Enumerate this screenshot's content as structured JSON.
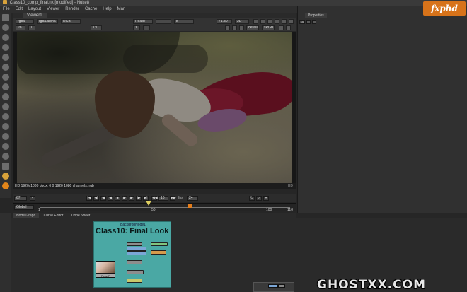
{
  "window": {
    "title": "Class10_comp_final.nk [modified] - Nuke8"
  },
  "menu": [
    "File",
    "Edit",
    "Layout",
    "Viewer",
    "Render",
    "Cache",
    "Help",
    "Mari"
  ],
  "viewer": {
    "tab_label": "Viewer1",
    "channels": "rgba",
    "alpha_channel": "rgba.alpha",
    "color_mode": "RGB",
    "input_a": "Read7",
    "input_b_label": "B",
    "gain": "f/8",
    "gain_value": "1",
    "zoom": "1:1",
    "gamma_label": "Y",
    "gamma_value": "1",
    "scale": "+1.30",
    "view_mode": "2D",
    "lut": "default",
    "colorspace": "sRGB",
    "info_line": "HD 1920x1080  bbox: 0 0 1920 1080  channels: rgb",
    "format_tag": "HD"
  },
  "playback": {
    "current_frame": "67",
    "step": "10",
    "fps_label": "fps",
    "fps_value": "24",
    "range_mode": "Global",
    "start_frame": "1",
    "end_frame": "110",
    "tick_50": "50",
    "tick_100": "100",
    "current_pct": 0.6
  },
  "node_graph": {
    "tabs": [
      "Node Graph",
      "Curve Editor",
      "Dope Sheet"
    ],
    "backdrop_name": "BackdropNode1",
    "backdrop_title": "Class10: Final Look",
    "read_node": "Read7"
  },
  "properties": {
    "tab_label": "Properties",
    "max_panels": "10"
  },
  "branding": {
    "logo": "fxphd",
    "watermark": "GHOSTXX.COM"
  },
  "colors": {
    "accent": "#e57d1a",
    "backdrop": "#4aa8a4"
  }
}
